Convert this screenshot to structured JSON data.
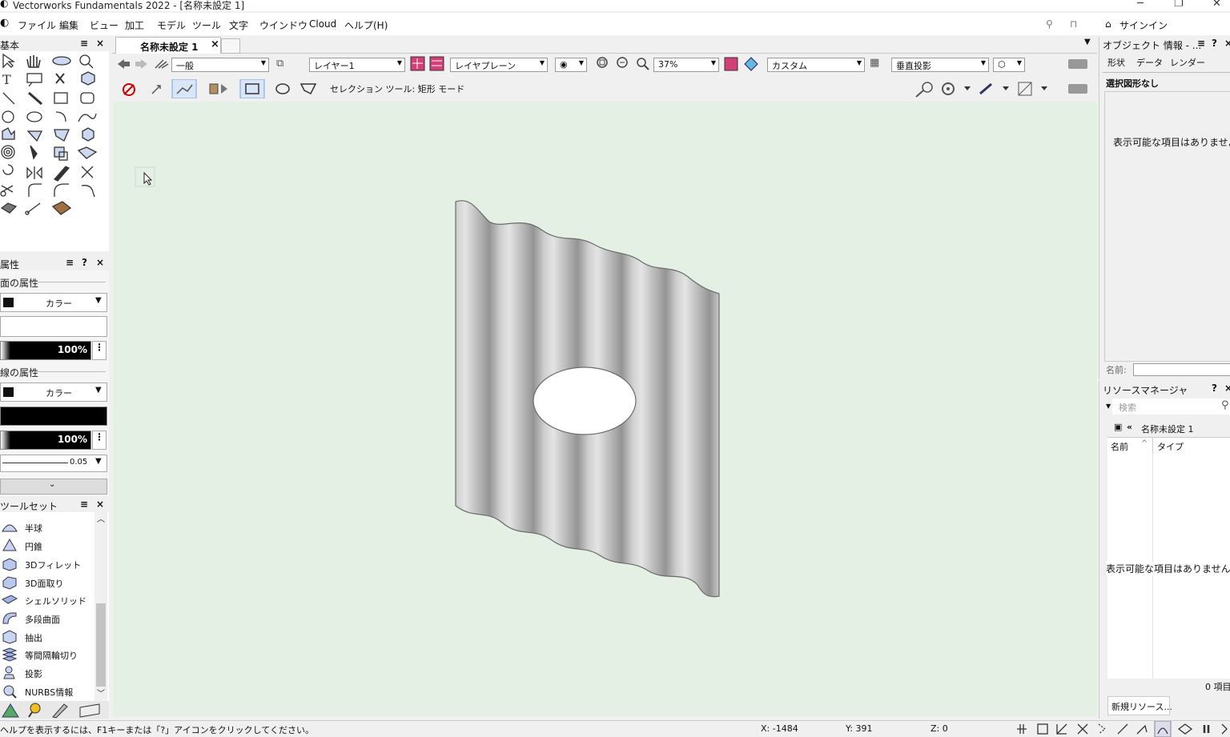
{
  "window": {
    "title": "Vectorworks Fundamentals 2022 - [名称未設定 1]"
  },
  "menu": [
    "ファイル",
    "編集",
    "ビュー",
    "加工",
    "モデル",
    "ツール",
    "文字",
    "ウインドウ",
    "Cloud",
    "ヘルプ(H)"
  ],
  "signin": "サインイン",
  "doc_tab": {
    "label": "名称未設定 1",
    "close": "×"
  },
  "view_bar": {
    "class": "一般",
    "layer": "レイヤー1",
    "layer_plane": "レイヤプレーン",
    "zoom": "37%",
    "render_mode": "カスタム",
    "projection": "垂直投影"
  },
  "mode_bar": {
    "label": "セレクション ツール: 矩形 モード"
  },
  "palettes": {
    "basic": {
      "title": "基本"
    },
    "attributes": {
      "title": "属性",
      "fill_section": "面の属性",
      "fill_type": "カラー",
      "fill_opacity": "100%",
      "line_section": "線の属性",
      "line_type": "カラー",
      "line_opacity": "100%",
      "line_weight": "0.05"
    },
    "toolset": {
      "title": "ツールセット",
      "items": [
        "半球",
        "円錐",
        "3Dフィレット",
        "3D面取り",
        "シェルソリッド",
        "多段曲面",
        "抽出",
        "等間隔輪切り",
        "投影",
        "NURBS情報"
      ]
    }
  },
  "obj_info": {
    "title": "オブジェクト 情報 - ...",
    "tabs": [
      "形状",
      "データ",
      "レンダー"
    ],
    "selection": "選択図形なし",
    "empty": "表示可能な項目はありません",
    "name_label": "名前:"
  },
  "resource_manager": {
    "title": "リソースマネージャ",
    "search_placeholder": "検索",
    "file": "名称未設定 1",
    "col_name": "名前",
    "col_type": "タイプ",
    "empty": "表示可能な項目はありません",
    "count": "0 項目",
    "new_button": "新規リソース..."
  },
  "status": {
    "help": "ヘルプを表示するには、F1キーまたは「?」アイコンをクリックしてください。",
    "x": "X: -1484",
    "y": "Y: 391",
    "z": "Z: 0"
  },
  "colors": {
    "drawing_bg": "#e4f0e4",
    "panel_bg": "#f0f0f0"
  }
}
